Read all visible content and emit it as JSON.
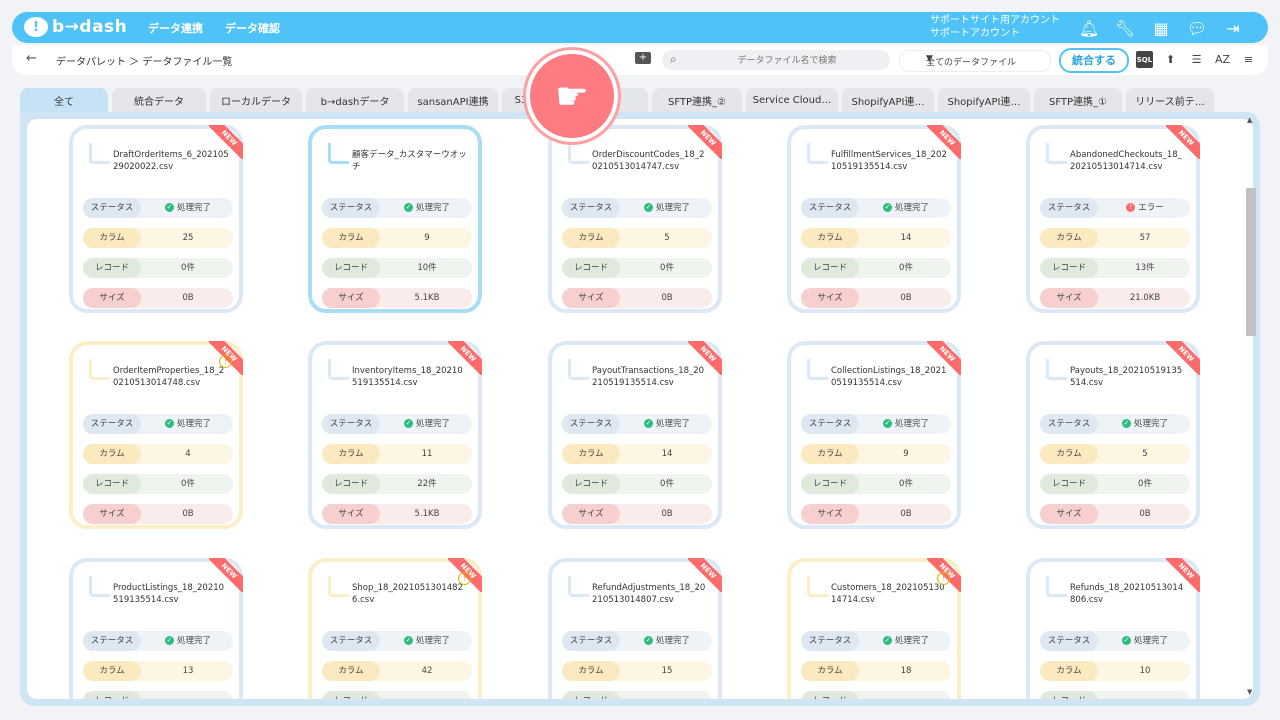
{
  "app": {
    "logo_text": "b→dash",
    "logo_mark": "!"
  },
  "nav": [
    {
      "label": "データ連携"
    },
    {
      "label": "データ確認"
    }
  ],
  "account": {
    "line1": "サポートサイト用アカウント",
    "line2": "サポートアカウント"
  },
  "top_icons": [
    "bell-icon",
    "wrench-icon",
    "grid-icon",
    "chat-icon",
    "logout-icon"
  ],
  "toolbar": {
    "back": "←",
    "breadcrumb": "データパレット ＞ データファイル一覧",
    "search_placeholder": "データファイル名で検索",
    "filter_selected": "全てのデータファイル",
    "merge_label": "統合する",
    "sql_label": "SQL"
  },
  "tabs": [
    {
      "label": "全て",
      "active": true
    },
    {
      "label": "統合データ"
    },
    {
      "label": "ローカルデータ"
    },
    {
      "label": "b→dashデータ"
    },
    {
      "label": "sansanAPI連携"
    },
    {
      "label": "S3"
    },
    {
      "label": "e_API…"
    },
    {
      "label": "SFTP連携_②"
    },
    {
      "label": "Service Cloud…"
    },
    {
      "label": "ShopifyAPI連…"
    },
    {
      "label": "ShopifyAPI連…"
    },
    {
      "label": "SFTP連携_①"
    },
    {
      "label": "リリース前テ…"
    }
  ],
  "labels": {
    "status": "ステータス",
    "column": "カラム",
    "record": "レコード",
    "size": "サイズ",
    "new": "NEW"
  },
  "cards": [
    {
      "name": "DraftOrderItems_6_20210529020022.csv",
      "status": "処理完了",
      "status_type": "ok",
      "columns": "25",
      "records": "0件",
      "size": "0B",
      "style": "default",
      "new": true
    },
    {
      "name": "顧客データ_カスタマーウオッチ",
      "status": "処理完了",
      "status_type": "ok",
      "columns": "9",
      "records": "10件",
      "size": "5.1KB",
      "style": "blue",
      "new": false
    },
    {
      "name": "OrderDiscountCodes_18_20210513014747.csv",
      "status": "処理完了",
      "status_type": "ok",
      "columns": "5",
      "records": "0件",
      "size": "0B",
      "style": "default",
      "new": true
    },
    {
      "name": "FulfillmentServices_18_20210519135514.csv",
      "status": "処理完了",
      "status_type": "ok",
      "columns": "14",
      "records": "0件",
      "size": "0B",
      "style": "default",
      "new": true
    },
    {
      "name": "AbandonedCheckouts_18_20210513014714.csv",
      "status": "エラー",
      "status_type": "error",
      "columns": "57",
      "records": "13件",
      "size": "21.0KB",
      "style": "default",
      "new": true
    },
    {
      "name": "OrderItemProperties_18_20210513014748.csv",
      "status": "処理完了",
      "status_type": "ok",
      "columns": "4",
      "records": "0件",
      "size": "0B",
      "style": "yellow",
      "new": true,
      "warn": true
    },
    {
      "name": "InventoryItems_18_20210519135514.csv",
      "status": "処理完了",
      "status_type": "ok",
      "columns": "11",
      "records": "22件",
      "size": "5.1KB",
      "style": "default",
      "new": true
    },
    {
      "name": "PayoutTransactions_18_20210519135514.csv",
      "status": "処理完了",
      "status_type": "ok",
      "columns": "14",
      "records": "0件",
      "size": "0B",
      "style": "default",
      "new": true
    },
    {
      "name": "CollectionListings_18_20210519135514.csv",
      "status": "処理完了",
      "status_type": "ok",
      "columns": "9",
      "records": "0件",
      "size": "0B",
      "style": "default",
      "new": true
    },
    {
      "name": "Payouts_18_20210519135514.csv",
      "status": "処理完了",
      "status_type": "ok",
      "columns": "5",
      "records": "0件",
      "size": "0B",
      "style": "default",
      "new": true
    },
    {
      "name": "ProductListings_18_20210519135514.csv",
      "status": "処理完了",
      "status_type": "ok",
      "columns": "13",
      "records": "",
      "size": "",
      "style": "default",
      "new": true
    },
    {
      "name": "Shop_18_20210513014826.csv",
      "status": "処理完了",
      "status_type": "ok",
      "columns": "42",
      "records": "",
      "size": "",
      "style": "yellow",
      "new": true,
      "warn": true
    },
    {
      "name": "RefundAdjustments_18_20210513014807.csv",
      "status": "処理完了",
      "status_type": "ok",
      "columns": "15",
      "records": "",
      "size": "",
      "style": "default",
      "new": true
    },
    {
      "name": "Customers_18_20210513014714.csv",
      "status": "処理完了",
      "status_type": "ok",
      "columns": "18",
      "records": "",
      "size": "",
      "style": "yellow",
      "new": true,
      "warn": true
    },
    {
      "name": "Refunds_18_20210513014806.csv",
      "status": "処理完了",
      "status_type": "ok",
      "columns": "10",
      "records": "",
      "size": "",
      "style": "default",
      "new": true
    }
  ]
}
